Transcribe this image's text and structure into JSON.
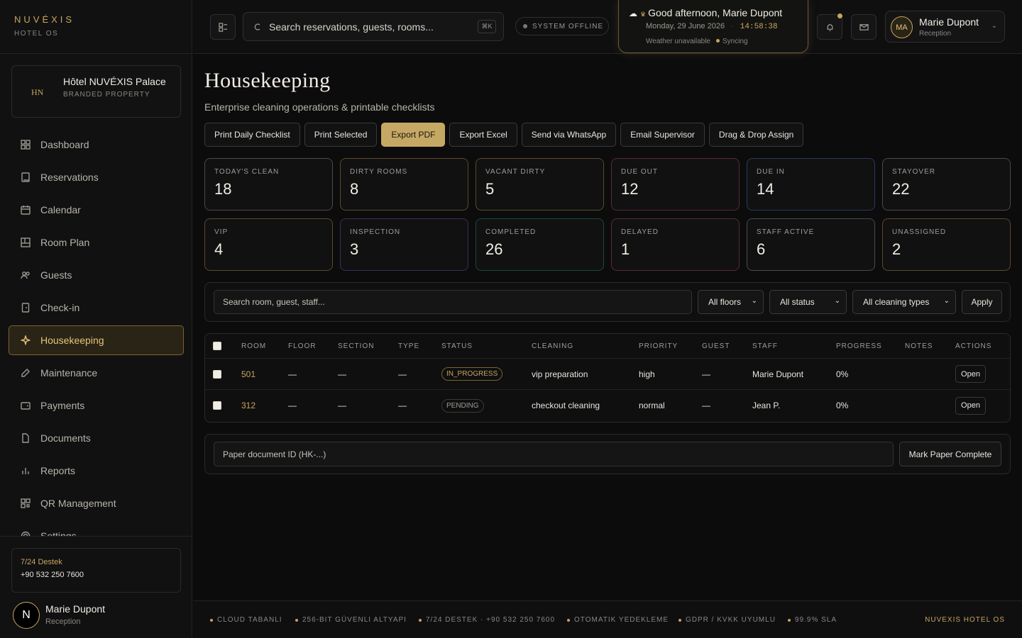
{
  "brand": {
    "logo": "NUVÉXIS",
    "subtitle": "HOTEL OS"
  },
  "property": {
    "initials": "HN",
    "name": "Hôtel NUVÉXIS Palace",
    "type": "BRANDED PROPERTY"
  },
  "sidebar": {
    "items": [
      {
        "label": "Dashboard",
        "icon": "grid-icon"
      },
      {
        "label": "Reservations",
        "icon": "book-icon"
      },
      {
        "label": "Calendar",
        "icon": "calendar-icon"
      },
      {
        "label": "Room Plan",
        "icon": "floorplan-icon"
      },
      {
        "label": "Guests",
        "icon": "users-icon"
      },
      {
        "label": "Check-in",
        "icon": "checkin-icon"
      },
      {
        "label": "Housekeeping",
        "icon": "sparkle-icon",
        "active": true
      },
      {
        "label": "Maintenance",
        "icon": "wrench-icon"
      },
      {
        "label": "Payments",
        "icon": "wallet-icon"
      },
      {
        "label": "Documents",
        "icon": "document-icon"
      },
      {
        "label": "Reports",
        "icon": "chart-icon"
      },
      {
        "label": "QR Management",
        "icon": "qr-icon"
      },
      {
        "label": "Settings",
        "icon": "gear-icon"
      }
    ]
  },
  "support": {
    "title": "7/24 Destek",
    "phone": "+90 532 250 7600"
  },
  "sidebar_user": {
    "initial": "N",
    "name": "Marie Dupont",
    "role": "Reception"
  },
  "topbar": {
    "search_placeholder": "Search reservations, guests, rooms...",
    "shortcut": "⌘K",
    "system_status": "SYSTEM OFFLINE",
    "greeting": "Good afternoon, Marie Dupont",
    "date": "Monday, 29 June 2026",
    "time": "14:58:38",
    "weather": "Weather unavailable",
    "sync": "Syncing",
    "user": {
      "initials": "MA",
      "name": "Marie Dupont",
      "role": "Reception"
    }
  },
  "page": {
    "title": "Housekeeping",
    "subtitle": "Enterprise cleaning operations & printable checklists"
  },
  "actions": [
    "Print Daily Checklist",
    "Print Selected",
    "Export PDF",
    "Export Excel",
    "Send via WhatsApp",
    "Email Supervisor",
    "Drag & Drop Assign"
  ],
  "stats": [
    {
      "label": "TODAY'S CLEAN",
      "value": "18",
      "color": "#4a4a4c"
    },
    {
      "label": "DIRTY ROOMS",
      "value": "8",
      "color": "#5a4a2a"
    },
    {
      "label": "VACANT DIRTY",
      "value": "5",
      "color": "#5a4a2a"
    },
    {
      "label": "DUE OUT",
      "value": "12",
      "color": "#5a2a2e"
    },
    {
      "label": "DUE IN",
      "value": "14",
      "color": "#2a3a5a"
    },
    {
      "label": "STAYOVER",
      "value": "22",
      "color": "#4a4a4c"
    },
    {
      "label": "VIP",
      "value": "4",
      "color": "#5a4a2a"
    },
    {
      "label": "INSPECTION",
      "value": "3",
      "color": "#3a2e5a"
    },
    {
      "label": "COMPLETED",
      "value": "26",
      "color": "#1e4a3a"
    },
    {
      "label": "DELAYED",
      "value": "1",
      "color": "#5a2a2e"
    },
    {
      "label": "STAFF ACTIVE",
      "value": "6",
      "color": "#4a4a4c"
    },
    {
      "label": "UNASSIGNED",
      "value": "2",
      "color": "#5a4a2a"
    }
  ],
  "filters": {
    "search_placeholder": "Search room, guest, staff...",
    "floor": "All floors",
    "status": "All status",
    "cleaning": "All cleaning types",
    "apply": "Apply"
  },
  "table": {
    "headers": [
      "ROOM",
      "FLOOR",
      "SECTION",
      "TYPE",
      "STATUS",
      "CLEANING",
      "PRIORITY",
      "GUEST",
      "STAFF",
      "PROGRESS",
      "NOTES",
      "ACTIONS"
    ],
    "rows": [
      {
        "room": "501",
        "floor": "—",
        "section": "—",
        "type": "—",
        "status": "IN_PROGRESS",
        "cleaning": "vip preparation",
        "priority": "high",
        "guest": "—",
        "staff": "Marie Dupont",
        "progress": "0%",
        "notes": "",
        "action": "Open"
      },
      {
        "room": "312",
        "floor": "—",
        "section": "—",
        "type": "—",
        "status": "PENDING",
        "cleaning": "checkout cleaning",
        "priority": "normal",
        "guest": "—",
        "staff": "Jean P.",
        "progress": "0%",
        "notes": "",
        "action": "Open"
      }
    ]
  },
  "paper": {
    "placeholder": "Paper document ID (HK-...)",
    "button": "Mark Paper Complete"
  },
  "footer": {
    "items": [
      "CLOUD TABANLI",
      "256-BIT GÜVENLI ALTYAPI",
      "7/24 DESTEK · +90 532 250 7600",
      "OTOMATIK YEDEKLEME",
      "GDPR / KVKK UYUMLU",
      "99.9% SLA"
    ],
    "brand": "NUVEXIS HOTEL OS"
  }
}
